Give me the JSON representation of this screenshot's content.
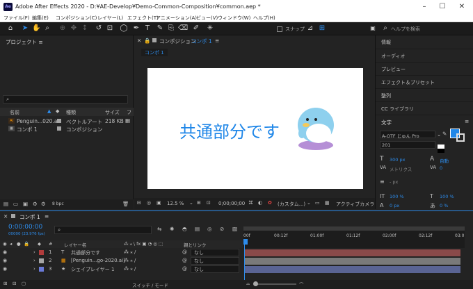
{
  "window": {
    "app_icon": "Ae",
    "title": "Adobe After Effects 2020 - D:¥AE-Develop¥Demo-Common-Composition¥common.aep *"
  },
  "menu": [
    "ファイル(F)",
    "編集(E)",
    "コンポジション(C)",
    "レイヤー(L)",
    "エフェクト(T)",
    "アニメーション(A)",
    "ビュー(V)",
    "ウィンドウ(W)",
    "ヘルプ(H)"
  ],
  "toolbar": {
    "snap_label": "スナップ",
    "search_placeholder": "ヘルプを検索"
  },
  "project": {
    "title": "プロジェクト",
    "menu_glyph": "≡",
    "search_icon": "⌕",
    "headers": {
      "name": "名前",
      "type": "種類",
      "size": "サイズ",
      "more": "フ"
    },
    "rows": [
      {
        "name": "Penguin...020.ai",
        "type": "ベクトルアート",
        "size": "218 KB",
        "color": "#a6a6a6"
      },
      {
        "name": "コンポ 1",
        "type": "コンポジション",
        "size": "",
        "color": "#a6a6a6"
      }
    ],
    "bpc": "8 bpc"
  },
  "comp": {
    "tab_prefix": "コンポジション",
    "tab_name": "コンポ 1",
    "flow_label": "コンポ 1",
    "canvas_text": "共通部分です",
    "zoom": "12.5 %",
    "timecode": "0;00;00;00",
    "camera_dropdown": "(カスタム...)",
    "active_camera": "アクティブカメラ"
  },
  "right_panels": [
    "情報",
    "オーディオ",
    "プレビュー",
    "エフェクト＆プリセット",
    "整列",
    "CC ライブラリ"
  ],
  "character": {
    "title": "文字",
    "font": "A-OTF じゅん Pro",
    "style": "201",
    "size": "300 px",
    "leading": "自動",
    "kerning": "メトリクス",
    "tracking": "0",
    "stroke": "- px",
    "vscale": "100 %",
    "hscale": "100 %",
    "baseline": "0 px",
    "tsume": "0 %",
    "fill_color": "#1e86e8"
  },
  "timeline": {
    "tab": "コンポ 1",
    "timecode": "0:00:00:00",
    "fps": "00000 (23.976 fps)",
    "headers": {
      "num": "#",
      "layer_name": "レイヤー名",
      "parent": "親とリンク"
    },
    "ruler": [
      "00f",
      "00:12f",
      "01:00f",
      "01:12f",
      "02:00f",
      "02:12f",
      "03:0"
    ],
    "layers": [
      {
        "num": "1",
        "type_icon": "T",
        "name": "共通部分です",
        "label_color": "#b13c3c",
        "parent": "なし",
        "bar_color": "#8a4a4a"
      },
      {
        "num": "2",
        "type_icon": "▦",
        "name": "[Penguin...go-2020.ai]",
        "label_color": "#a6a6a6",
        "parent": "なし",
        "bar_color": "#7a7a7a"
      },
      {
        "num": "3",
        "type_icon": "★",
        "name": "シェイプレイヤー 1",
        "label_color": "#6a7ad8",
        "parent": "なし",
        "bar_color": "#5a6494"
      }
    ],
    "toggle_label": "スイッチ / モード"
  },
  "colors": {
    "accent": "#2d8ceb",
    "canvas_bg": "#ffffff",
    "penguin": "#8ed0ee",
    "shadow": "#b58fd6"
  }
}
